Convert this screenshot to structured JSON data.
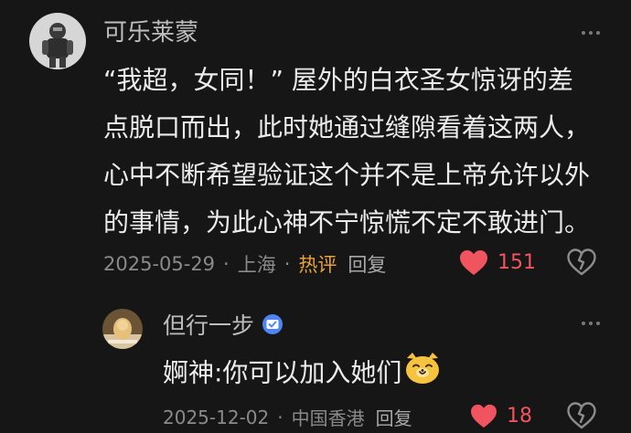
{
  "comment": {
    "username": "可乐莱蒙",
    "lines": [
      "“我超，女同！” 屋外的白衣圣女惊讶的差",
      "点脱口而出，此时她通过缝隙看着这两人，",
      "心中不断希望验证这个并不是上帝允许以外",
      "的事情，为此心神不宁惊慌不定不敢进门。"
    ],
    "date": "2025-05-29",
    "location": "上海",
    "hot_label": "热评",
    "reply_label": "回复",
    "likes": "151"
  },
  "reply": {
    "username": "但行一步",
    "text": "婀神:你可以加入她们",
    "date": "2025-12-02",
    "location": "中国香港",
    "reply_label": "回复",
    "likes": "18"
  },
  "colors": {
    "background": "#161616",
    "like_red": "#f0545e",
    "hot_orange": "#e8a23c",
    "verified_blue": "#4d86f2"
  },
  "icons": {
    "more": "more-dots-icon",
    "like": "heart-icon",
    "dislike": "broken-heart-icon",
    "verified": "verified-badge-icon",
    "emoji": "cat-face-emoji-icon"
  }
}
